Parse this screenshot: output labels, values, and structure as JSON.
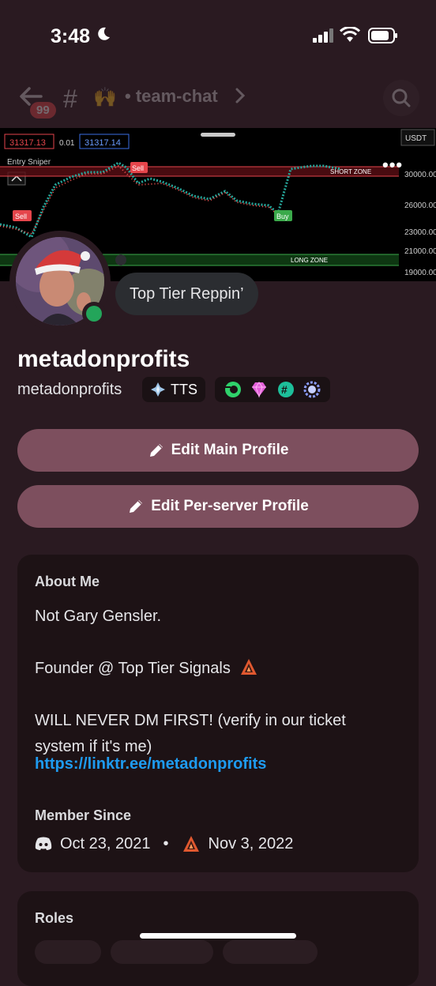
{
  "status_bar": {
    "time": "3:48"
  },
  "channel_header": {
    "unread_count": "99",
    "channel_name": "team-chat",
    "separator": "•"
  },
  "banner": {
    "price_ask": "31317.13",
    "spread": "0.01",
    "price_bid": "31317.14",
    "currency": "USDT",
    "indicator_name": "Entry Sniper",
    "short_zone_label": "SHORT ZONE",
    "long_zone_label": "LONG ZONE",
    "sell_label_1": "Sell",
    "sell_label_2": "Sell",
    "buy_label": "Buy",
    "price_ticks": [
      "30000.00",
      "26000.00",
      "23000.00",
      "21000.00",
      "19000.00"
    ]
  },
  "profile": {
    "status_tooltip": "Top Tier Reppin’",
    "display_name": "metadonprofits",
    "username": "metadonprofits",
    "server_tag": "TTS",
    "status": "online",
    "status_color": "#23a55a"
  },
  "actions": {
    "edit_main_profile": "Edit Main Profile",
    "edit_server_profile": "Edit Per-server Profile"
  },
  "about": {
    "title": "About Me",
    "bio": "Not Gary Gensler.\n\nFounder @ Top Tier Signals\n\nWILL NEVER DM FIRST! (verify in our ticket system if it's me)",
    "link": "https://linktr.ee/metadonprofits"
  },
  "member_since": {
    "title": "Member Since",
    "discord_date": "Oct 23, 2021",
    "separator": "•",
    "server_date": "Nov 3, 2022"
  },
  "roles": {
    "title": "Roles"
  },
  "colors": {
    "accent_button": "#7d4f5e",
    "background": "#2a1a21",
    "link": "#1e9bf0"
  }
}
